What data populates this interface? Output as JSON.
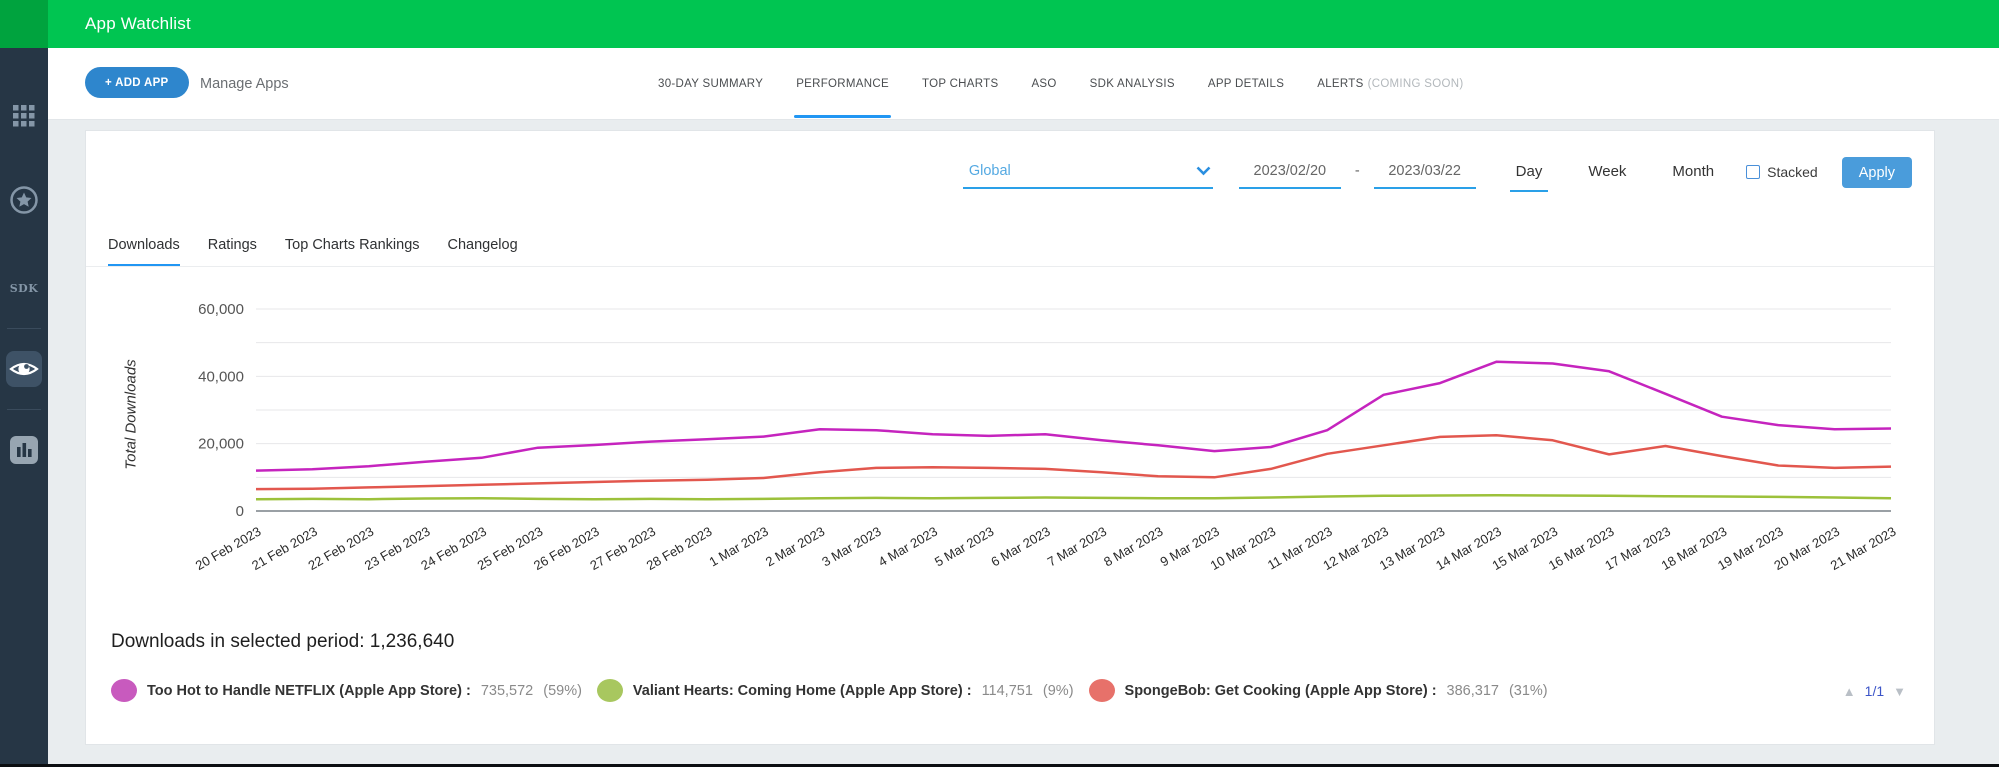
{
  "header": {
    "title": "App Watchlist"
  },
  "sidebar": {
    "sdk_label": "SDK",
    "items": [
      {
        "icon": "grid-icon",
        "active": false
      },
      {
        "icon": "star-circle-icon",
        "active": false
      },
      {
        "icon": "sdk-icon",
        "active": false
      },
      {
        "icon": "eye-icon",
        "active": true
      },
      {
        "icon": "bar-chart-icon",
        "active": false
      }
    ]
  },
  "toolbar": {
    "add_app_label": "+ ADD APP",
    "manage_apps_label": "Manage Apps",
    "tabs": [
      {
        "label": "30-DAY SUMMARY"
      },
      {
        "label": "PERFORMANCE",
        "active": true
      },
      {
        "label": "TOP CHARTS"
      },
      {
        "label": "ASO"
      },
      {
        "label": "SDK ANALYSIS"
      },
      {
        "label": "APP DETAILS"
      },
      {
        "label": "ALERTS",
        "suffix": "(COMING SOON)"
      }
    ]
  },
  "filters": {
    "region": "Global",
    "date_from": "2023/02/20",
    "date_sep": "-",
    "date_to": "2023/03/22",
    "granularity": [
      "Day",
      "Week",
      "Month"
    ],
    "active_granularity": "Day",
    "stacked_label": "Stacked",
    "stacked_checked": false,
    "apply_label": "Apply"
  },
  "chart_tabs": [
    {
      "label": "Downloads",
      "active": true
    },
    {
      "label": "Ratings"
    },
    {
      "label": "Top Charts Rankings"
    },
    {
      "label": "Changelog"
    }
  ],
  "summary": {
    "text": "Downloads in selected period: 1,236,640"
  },
  "legend": [
    {
      "name": "Too Hot to Handle NETFLIX (Apple App Store) :",
      "value": "735,572",
      "pct": "(59%)",
      "color": "#c85abe"
    },
    {
      "name": "Valiant Hearts: Coming Home (Apple App Store) :",
      "value": "114,751",
      "pct": "(9%)",
      "color": "#a8c75f"
    },
    {
      "name": "SpongeBob: Get Cooking (Apple App Store) :",
      "value": "386,317",
      "pct": "(31%)",
      "color": "#e7716a"
    }
  ],
  "pagination": {
    "up": "▲",
    "page": "1/1",
    "down": "▼"
  },
  "chart_data": {
    "type": "line",
    "title": "",
    "xlabel": "",
    "ylabel": "Total Downloads",
    "ylim": [
      0,
      65000
    ],
    "yticks": [
      0,
      20000,
      40000,
      60000
    ],
    "grid_step": 10000,
    "grid": true,
    "legend_position": "bottom",
    "categories": [
      "20 Feb 2023",
      "21 Feb 2023",
      "22 Feb 2023",
      "23 Feb 2023",
      "24 Feb 2023",
      "25 Feb 2023",
      "26 Feb 2023",
      "27 Feb 2023",
      "28 Feb 2023",
      "1 Mar 2023",
      "2 Mar 2023",
      "3 Mar 2023",
      "4 Mar 2023",
      "5 Mar 2023",
      "6 Mar 2023",
      "7 Mar 2023",
      "8 Mar 2023",
      "9 Mar 2023",
      "10 Mar 2023",
      "11 Mar 2023",
      "12 Mar 2023",
      "13 Mar 2023",
      "14 Mar 2023",
      "15 Mar 2023",
      "16 Mar 2023",
      "17 Mar 2023",
      "18 Mar 2023",
      "19 Mar 2023",
      "20 Mar 2023",
      "21 Mar 2023"
    ],
    "series": [
      {
        "name": "Too Hot to Handle NETFLIX (Apple App Store)",
        "color": "#c524be",
        "values": [
          12000,
          12400,
          13300,
          14600,
          15800,
          18800,
          19600,
          20600,
          21300,
          22100,
          24300,
          24000,
          22800,
          22300,
          22800,
          21000,
          19500,
          17800,
          19000,
          24000,
          34500,
          38000,
          44300,
          43800,
          41500,
          34800,
          28000,
          25500,
          24300,
          24500
        ]
      },
      {
        "name": "Valiant Hearts: Coming Home (Apple App Store)",
        "color": "#9cc13b",
        "values": [
          3500,
          3600,
          3500,
          3700,
          3800,
          3600,
          3500,
          3600,
          3500,
          3600,
          3800,
          3900,
          3800,
          3900,
          4000,
          3900,
          3800,
          3800,
          4000,
          4300,
          4500,
          4600,
          4700,
          4600,
          4500,
          4400,
          4300,
          4200,
          4000,
          3800
        ]
      },
      {
        "name": "SpongeBob: Get Cooking (Apple App Store)",
        "color": "#e2574e",
        "values": [
          6500,
          6600,
          7000,
          7400,
          7800,
          8200,
          8600,
          9000,
          9300,
          9800,
          11500,
          12800,
          13000,
          12800,
          12500,
          11500,
          10300,
          10000,
          12500,
          17000,
          19500,
          22000,
          22500,
          21000,
          16800,
          19300,
          16300,
          13500,
          12800,
          13200
        ]
      }
    ]
  }
}
